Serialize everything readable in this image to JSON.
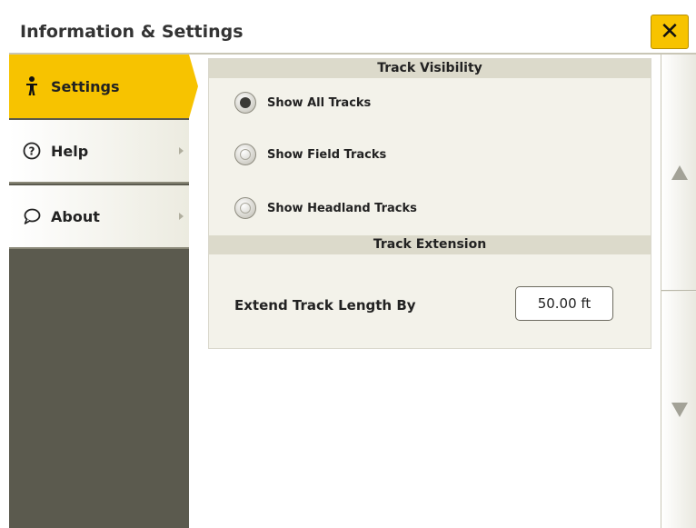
{
  "header": {
    "title": "Information & Settings",
    "close_icon": "close-icon",
    "close_label": "✕"
  },
  "sidebar": {
    "items": [
      {
        "label": "Settings",
        "icon": "person-standing-icon",
        "active": true
      },
      {
        "label": "Help",
        "icon": "question-circle-icon",
        "active": false
      },
      {
        "label": "About",
        "icon": "speech-bubble-icon",
        "active": false
      }
    ]
  },
  "track_visibility": {
    "header": "Track Visibility",
    "options": [
      {
        "label": "Show All Tracks",
        "selected": true
      },
      {
        "label": "Show Field Tracks",
        "selected": false
      },
      {
        "label": "Show Headland Tracks",
        "selected": false
      }
    ]
  },
  "track_extension": {
    "header": "Track Extension",
    "field_label": "Extend Track Length By",
    "value": "50.00 ft"
  },
  "scroll": {
    "up_icon": "scroll-up-icon",
    "down_icon": "scroll-down-icon"
  },
  "colors": {
    "accent": "#f7c300",
    "sidebar_bg": "#5b5a4e",
    "section_header_bg": "#dcdacb"
  }
}
